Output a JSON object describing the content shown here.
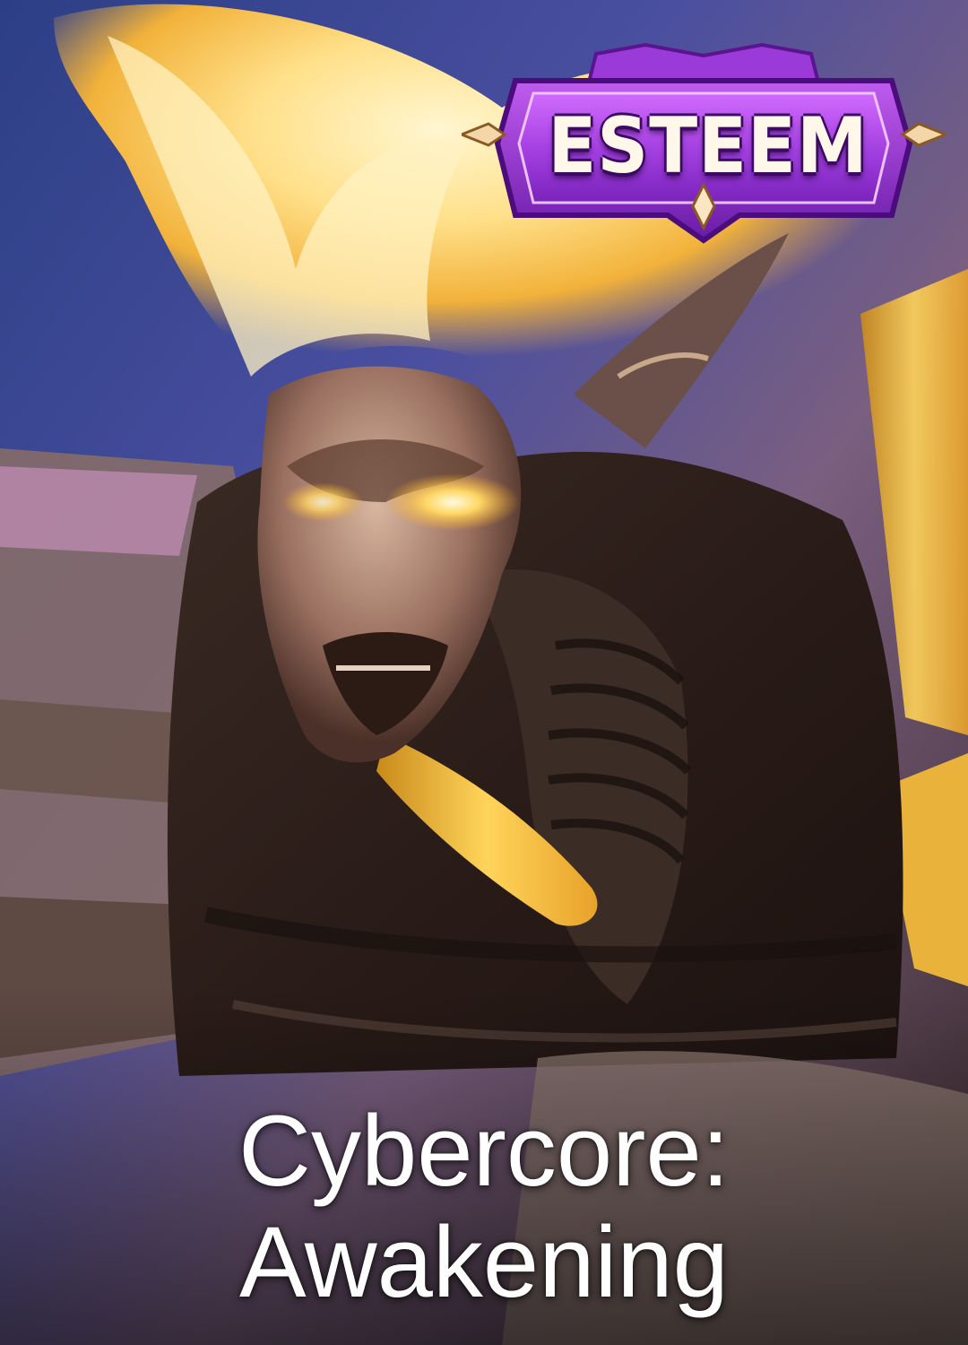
{
  "badge": {
    "label": "ESTEEM",
    "colors": {
      "outer": "#7a1fb8",
      "inner": "#b349e8",
      "gem": "#f3d7a8"
    }
  },
  "skin": {
    "title_line1": "Cybercore:",
    "title_line2": "Awakening"
  },
  "art": {
    "palette": {
      "sky": "#3b4a8a",
      "flame": "#ffd35c",
      "armor": "#2b1e1a",
      "metal": "#8b6b5a",
      "glow": "#ffe9a6"
    }
  }
}
